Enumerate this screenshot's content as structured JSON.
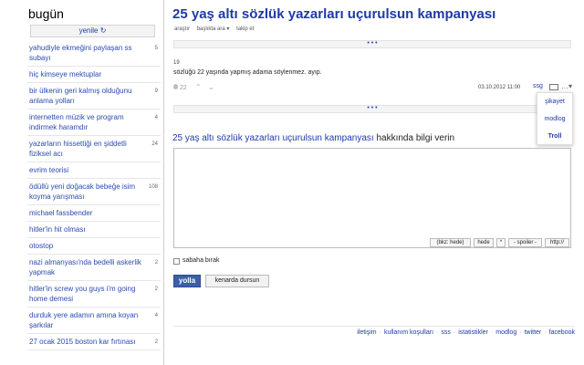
{
  "sidebar": {
    "title": "bugün",
    "refresh_label": "yenile ↻",
    "items": [
      {
        "label": "yahudiyle ekmeğini paylaşan ss subayı",
        "count": "5"
      },
      {
        "label": "hiç kimseye mektuplar",
        "count": ""
      },
      {
        "label": "bir ülkenin geri kalmış olduğunu anlama yolları",
        "count": "9"
      },
      {
        "label": "internetten müzik ve program indirmek haramdır",
        "count": "4"
      },
      {
        "label": "yazarların hissettiği en şiddetli fiziksel acı",
        "count": "24"
      },
      {
        "label": "evrim teorisi",
        "count": ""
      },
      {
        "label": "ödüllü yeni doğacak bebeğe isim koyma yarışması",
        "count": "108"
      },
      {
        "label": "michael fassbender",
        "count": ""
      },
      {
        "label": "hitler'in hit olması",
        "count": ""
      },
      {
        "label": "otostop",
        "count": ""
      },
      {
        "label": "nazi almanyası'nda bedelli askerlik yapmak",
        "count": "2"
      },
      {
        "label": "hitler'in screw you guys i'm going home demesi",
        "count": "2"
      },
      {
        "label": "durduk yere adamın amına koyan şarkılar",
        "count": "4"
      },
      {
        "label": "27 ocak 2015 boston kar fırtınası",
        "count": "2"
      }
    ]
  },
  "topic": {
    "title": "25 yaş altı sözlük yazarları uçurulsun kampanyası",
    "tools": [
      "araştır",
      "başlıkta ara ▾",
      "takip et"
    ],
    "dots": "• • •"
  },
  "entry": {
    "number": "19",
    "text": "sözlüğü 22 yaşında yapmış adama söylenmez. ayıp.",
    "fav_count": "22",
    "up_icon": "⌃",
    "down_icon": "⌄",
    "date": "03.10.2012 11:00",
    "author": "ssg",
    "more_icon": "…▾"
  },
  "menu": {
    "items": [
      "şikayet",
      "modlog",
      "Troll"
    ]
  },
  "reply": {
    "topic_link": "25 yaş altı sözlük yazarları uçurulsun kampanyası",
    "suffix": " hakkında bilgi verin",
    "format_buttons": [
      "(bkz: hede)",
      "hede",
      "*",
      "- spoiler -",
      "http://"
    ],
    "checkbox_label": "sabaha bırak",
    "send_label": "yolla",
    "keep_label": "kenarda dursun"
  },
  "footer": {
    "links": [
      "iletişim",
      "kullanım koşulları",
      "sss",
      "istatistikler",
      "modlog",
      "twitter",
      "facebook"
    ]
  }
}
